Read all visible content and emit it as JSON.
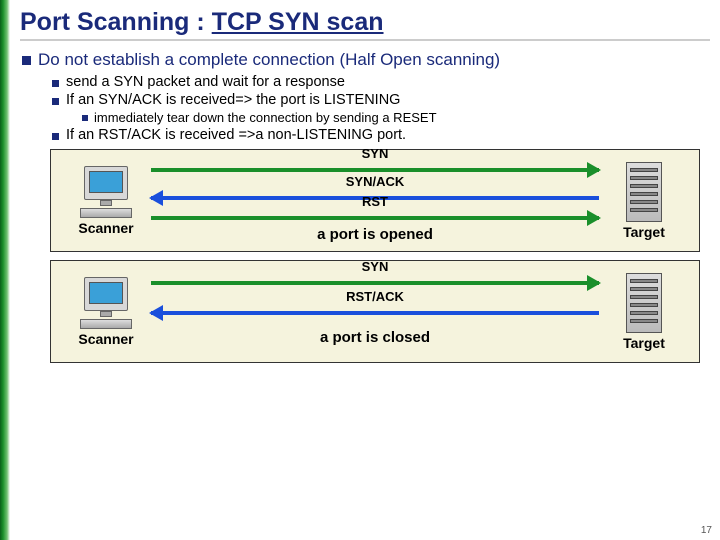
{
  "title_prefix": "Port Scanning : ",
  "title_under": "TCP SYN scan",
  "bullets": {
    "main": "Do not establish a complete connection (Half Open scanning)",
    "sub1": "send a SYN packet and wait for a response",
    "sub2": "If an SYN/ACK is received=> the port is LISTENING",
    "subsub": "immediately tear down the connection by sending a RESET",
    "sub3": "If an RST/ACK is received =>a non-LISTENING port."
  },
  "diag1": {
    "scanner": "Scanner",
    "target": "Target",
    "a1": "SYN",
    "a2": "SYN/ACK",
    "a3": "RST",
    "result": "a port is opened"
  },
  "diag2": {
    "scanner": "Scanner",
    "target": "Target",
    "a1": "SYN",
    "a2": "RST/ACK",
    "result": "a port is closed"
  },
  "page_number": "17"
}
